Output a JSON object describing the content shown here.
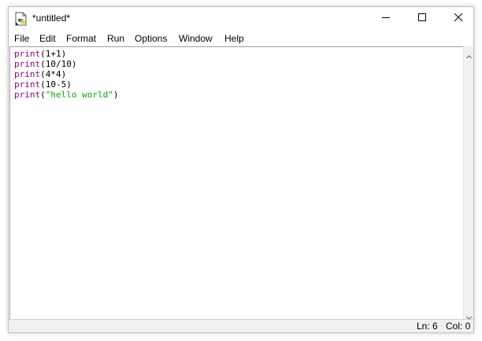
{
  "window": {
    "title": "*untitled*",
    "app_icon": "idle-python-file-icon",
    "controls": {
      "minimize_icon": "minimize-icon",
      "maximize_icon": "maximize-icon",
      "close_icon": "close-icon"
    }
  },
  "menu": {
    "items": [
      {
        "label": "File"
      },
      {
        "label": "Edit"
      },
      {
        "label": "Format"
      },
      {
        "label": "Run"
      },
      {
        "label": "Options"
      },
      {
        "label": "Window"
      },
      {
        "label": "Help"
      }
    ]
  },
  "editor": {
    "lines": [
      {
        "keyword": "print",
        "open": "(",
        "literal": "1+1",
        "close": ")"
      },
      {
        "keyword": "print",
        "open": "(",
        "literal": "10/10",
        "close": ")"
      },
      {
        "keyword": "print",
        "open": "(",
        "literal": "4*4",
        "close": ")"
      },
      {
        "keyword": "print",
        "open": "(",
        "literal": "10-5",
        "close": ")"
      },
      {
        "keyword": "print",
        "open": "(",
        "string": "\"hello world\"",
        "close": ")"
      }
    ]
  },
  "status": {
    "line": "Ln: 6",
    "col": "Col: 0"
  },
  "colors": {
    "keyword": "#900090",
    "string": "#00aa00",
    "text": "#000000"
  }
}
